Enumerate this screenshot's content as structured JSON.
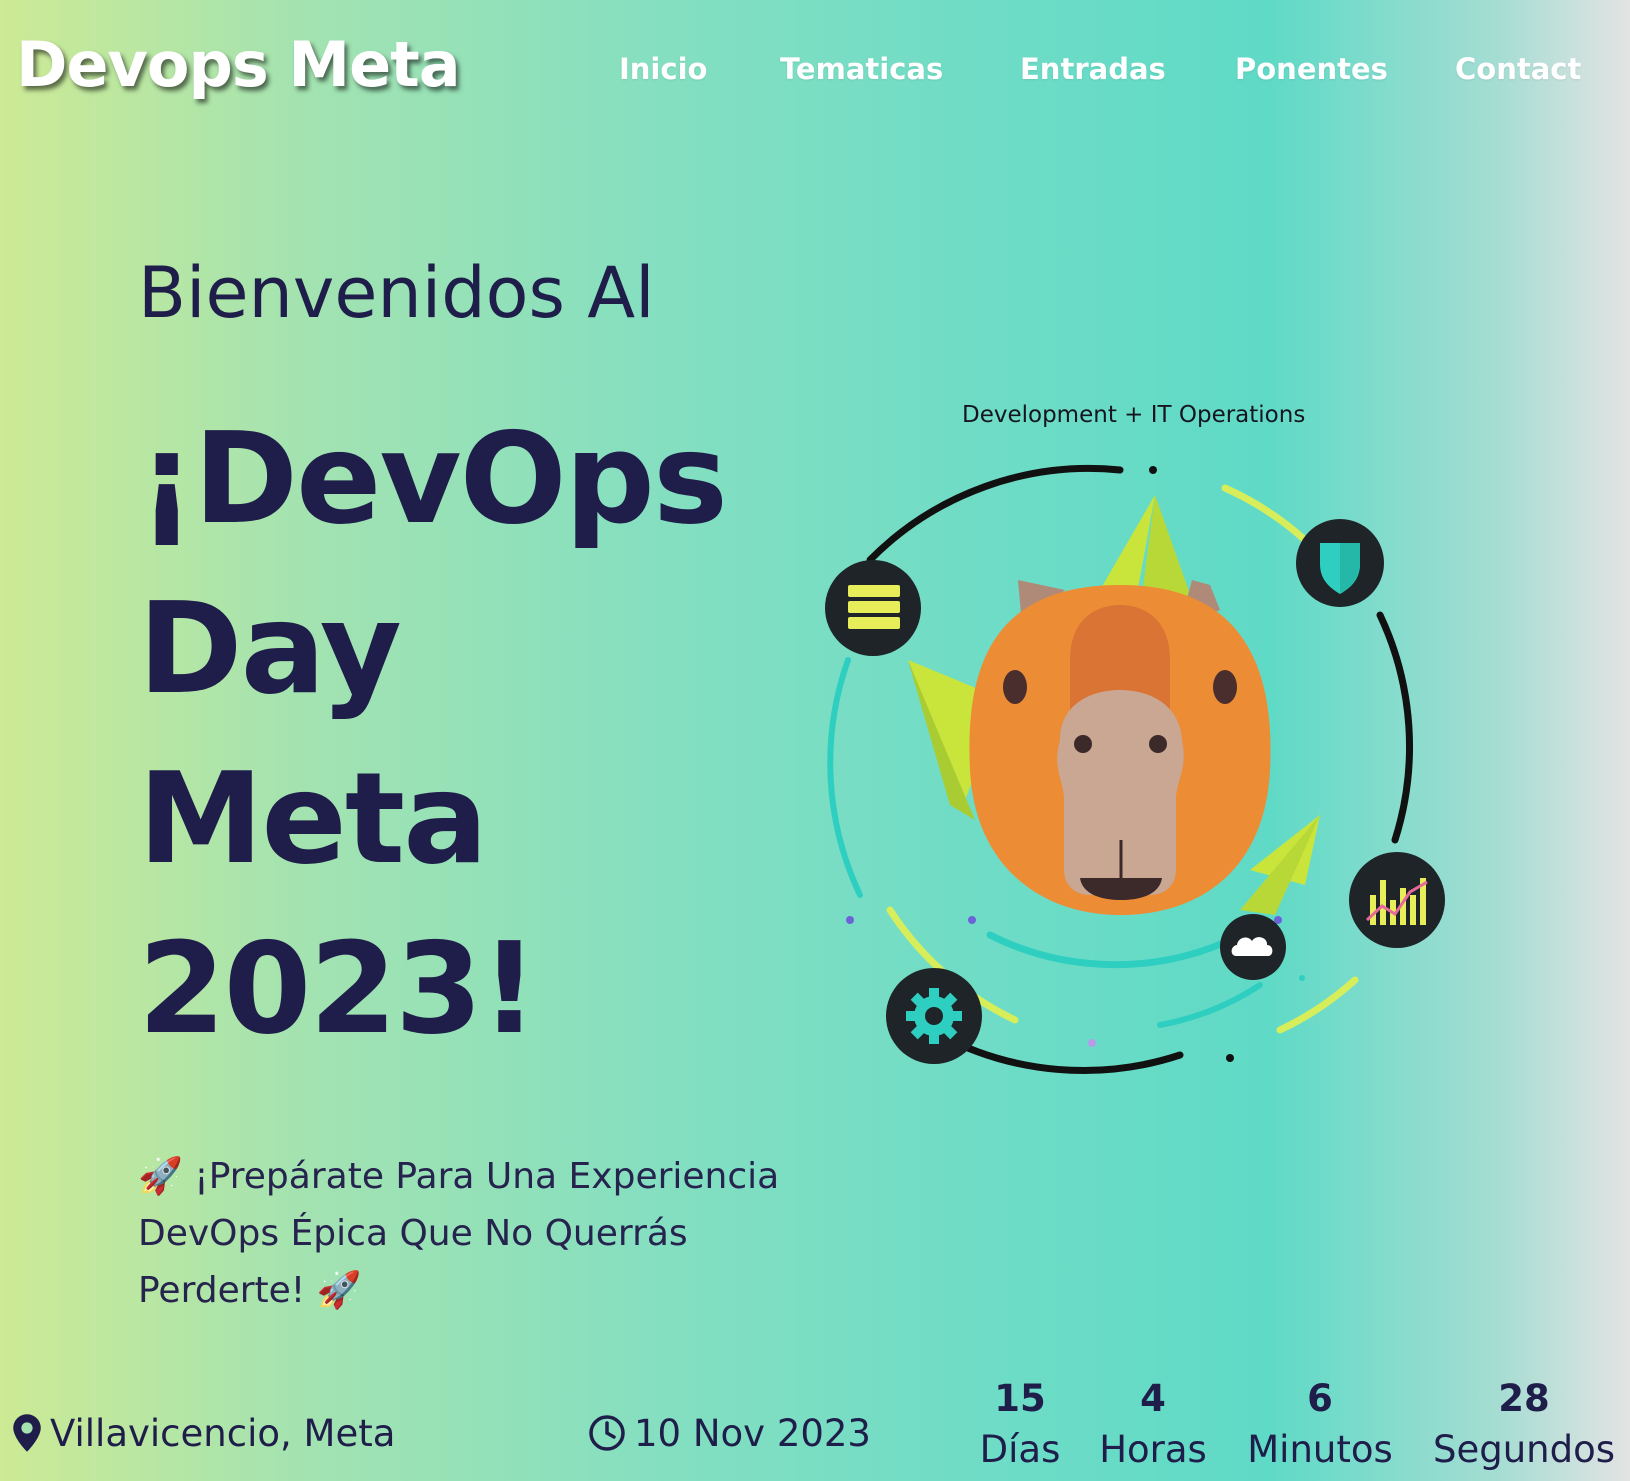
{
  "header": {
    "logo": "Devops Meta",
    "nav": [
      "Inicio",
      "Tematicas",
      "Entradas",
      "Ponentes",
      "Contact"
    ]
  },
  "hero": {
    "welcome": "Bienvenidos Al",
    "title_lines": [
      "¡DevOps",
      "Day",
      "Meta",
      "2023!"
    ],
    "tagline_parts": [
      "🚀 ¡Prepárate Para Una Experiencia",
      "DevOps Épica Que No Querrás",
      "Perderte! 🚀"
    ]
  },
  "illustration": {
    "caption": "Development + IT Operations",
    "icons": [
      "server-stack-icon",
      "shield-icon",
      "bar-chart-icon",
      "cloud-icon",
      "gear-icon",
      "capybara-mascot"
    ]
  },
  "event": {
    "location": "Villavicencio, Meta",
    "date": "10 Nov 2023",
    "location_icon": "map-pin-icon",
    "date_icon": "clock-icon"
  },
  "countdown": [
    {
      "value": "15",
      "label": "Días"
    },
    {
      "value": "4",
      "label": "Horas"
    },
    {
      "value": "6",
      "label": "Minutos"
    },
    {
      "value": "28",
      "label": "Segundos"
    }
  ],
  "colors": {
    "text_primary": "#1f1d4a",
    "gradient_left": "#cdea95",
    "gradient_mid": "#5fdac6",
    "gradient_right": "#e3e3e3",
    "accent_teal": "#2ecfc0",
    "accent_lime": "#d7ee5a",
    "mascot_orange": "#ec8c35"
  }
}
